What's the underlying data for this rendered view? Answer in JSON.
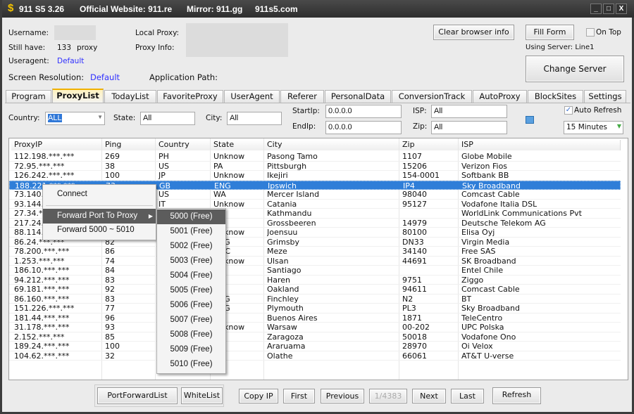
{
  "title": {
    "icon": "dollar-icon",
    "app": "911 S5 3.26",
    "website": "Official Website: 911.re",
    "mirror": "Mirror: 911.gg",
    "alt": "911s5.com"
  },
  "window_controls": [
    "minimize",
    "maximize",
    "close"
  ],
  "info": {
    "username_label": "Username:",
    "still_have_label": "Still have:",
    "still_have_count": "133",
    "still_have_unit": "proxy",
    "useragent_label": "Useragent:",
    "useragent_value": "Default",
    "screen_res_label": "Screen Resolution:",
    "screen_res_value": "Default",
    "local_proxy_label": "Local Proxy:",
    "proxy_info_label": "Proxy Info:",
    "app_path_label": "Application Path:",
    "using_server": "Using Server: Line1"
  },
  "buttons": {
    "clear_browser": "Clear browser info",
    "fill_form": "Fill Form",
    "on_top": "On Top",
    "change_server": "Change Server"
  },
  "tabs": [
    "Program",
    "ProxyList",
    "TodayList",
    "FavoriteProxy",
    "UserAgent",
    "Referer",
    "PersonalData",
    "ConversionTrack",
    "AutoProxy",
    "BlockSites",
    "Settings"
  ],
  "active_tab": "ProxyList",
  "filters": {
    "country_label": "Country:",
    "country_value": "ALL",
    "state_label": "State:",
    "state_value": "All",
    "city_label": "City:",
    "city_value": "All",
    "startip_label": "StartIp:",
    "startip_value": "0.0.0.0",
    "endip_label": "EndIp:",
    "endip_value": "0.0.0.0",
    "isp_label": "ISP:",
    "isp_value": "All",
    "zip_label": "Zip:",
    "zip_value": "All",
    "auto_refresh_label": "Auto Refresh",
    "auto_refresh_checked": true,
    "interval": "15 Minutes"
  },
  "table": {
    "columns": [
      "ProxyIP",
      "Ping",
      "Country",
      "State",
      "City",
      "Zip",
      "ISP"
    ],
    "selected_row": 3,
    "rows": [
      [
        "112.198.***.***",
        "269",
        "PH",
        "Unknow",
        "Pasong Tamo",
        "1107",
        "Globe Mobile"
      ],
      [
        "72.95.***.***",
        "38",
        "US",
        "PA",
        "Pittsburgh",
        "15206",
        "Verizon Fios"
      ],
      [
        "126.242.***.***",
        "100",
        "JP",
        "Unknow",
        "Ikejiri",
        "154-0001",
        "Softbank BB"
      ],
      [
        "188.221.***.***",
        "73",
        "GB",
        "ENG",
        "Ipswich",
        "IP4",
        "Sky Broadband"
      ],
      [
        "73.140.***.***",
        "",
        "US",
        "WA",
        "Mercer Island",
        "98040",
        "Comcast Cable"
      ],
      [
        "93.144.***.***",
        "",
        "IT",
        "Unknow",
        "Catania",
        "95127",
        "Vodafone Italia DSL"
      ],
      [
        "27.34.***.***",
        "",
        "",
        "",
        "Kathmandu",
        "",
        "WorldLink Communications Pvt"
      ],
      [
        "217.24.***.***",
        "",
        "",
        "",
        "Grossbeeren",
        "14979",
        "Deutsche Telekom AG"
      ],
      [
        "88.114.***.***",
        "",
        "",
        "Unknow",
        "Joensuu",
        "80100",
        "Elisa Oyj"
      ],
      [
        "86.24.***.***",
        "82",
        "",
        "ENG",
        "Grimsby",
        "DN33",
        "Virgin Media"
      ],
      [
        "78.200.***.***",
        "86",
        "",
        "OCC",
        "Meze",
        "34140",
        "Free SAS"
      ],
      [
        "1.253.***.***",
        "74",
        "",
        "Unknow",
        "Ulsan",
        "44691",
        "SK Broadband"
      ],
      [
        "186.10.***.***",
        "84",
        "",
        "",
        "Santiago",
        "",
        "Entel Chile"
      ],
      [
        "94.212.***.***",
        "83",
        "",
        "",
        "Haren",
        "9751",
        "Ziggo"
      ],
      [
        "69.181.***.***",
        "92",
        "",
        "",
        "Oakland",
        "94611",
        "Comcast Cable"
      ],
      [
        "86.160.***.***",
        "83",
        "",
        "ENG",
        "Finchley",
        "N2",
        "BT"
      ],
      [
        "151.226.***.***",
        "77",
        "",
        "ENG",
        "Plymouth",
        "PL3",
        "Sky Broadband"
      ],
      [
        "181.44.***.***",
        "96",
        "",
        "",
        "Buenos Aires",
        "1871",
        "TeleCentro"
      ],
      [
        "31.178.***.***",
        "93",
        "",
        "Unknow",
        "Warsaw",
        "00-202",
        "UPC Polska"
      ],
      [
        "2.152.***.***",
        "85",
        "",
        "",
        "Zaragoza",
        "50018",
        "Vodafone Ono"
      ],
      [
        "189.24.***.***",
        "100",
        "",
        "",
        "Araruama",
        "28970",
        "Oi Velox"
      ],
      [
        "104.62.***.***",
        "32",
        "",
        "",
        "Olathe",
        "66061",
        "AT&T U-verse"
      ]
    ]
  },
  "context_menu": {
    "items": [
      "Connect",
      "Forward Port To Proxy",
      "Forward 5000 ~ 5010"
    ],
    "highlighted": "Forward Port To Proxy",
    "submenu": [
      "5000 (Free)",
      "5001 (Free)",
      "5002 (Free)",
      "5003 (Free)",
      "5004 (Free)",
      "5005 (Free)",
      "5006 (Free)",
      "5007 (Free)",
      "5008 (Free)",
      "5009 (Free)",
      "5010 (Free)"
    ],
    "submenu_highlighted": "5000 (Free)"
  },
  "bottom": {
    "port_forward": "PortForwardList",
    "whitelist": "WhiteList",
    "copy_ip": "Copy IP",
    "first": "First",
    "previous": "Previous",
    "page": "1/4383",
    "next": "Next",
    "last": "Last",
    "refresh": "Refresh"
  },
  "colors": {
    "selection": "#2f7ed8",
    "menu_highlight": "#5c5c5c",
    "link": "#3030ff",
    "titlebar": "#3a3a3a"
  }
}
